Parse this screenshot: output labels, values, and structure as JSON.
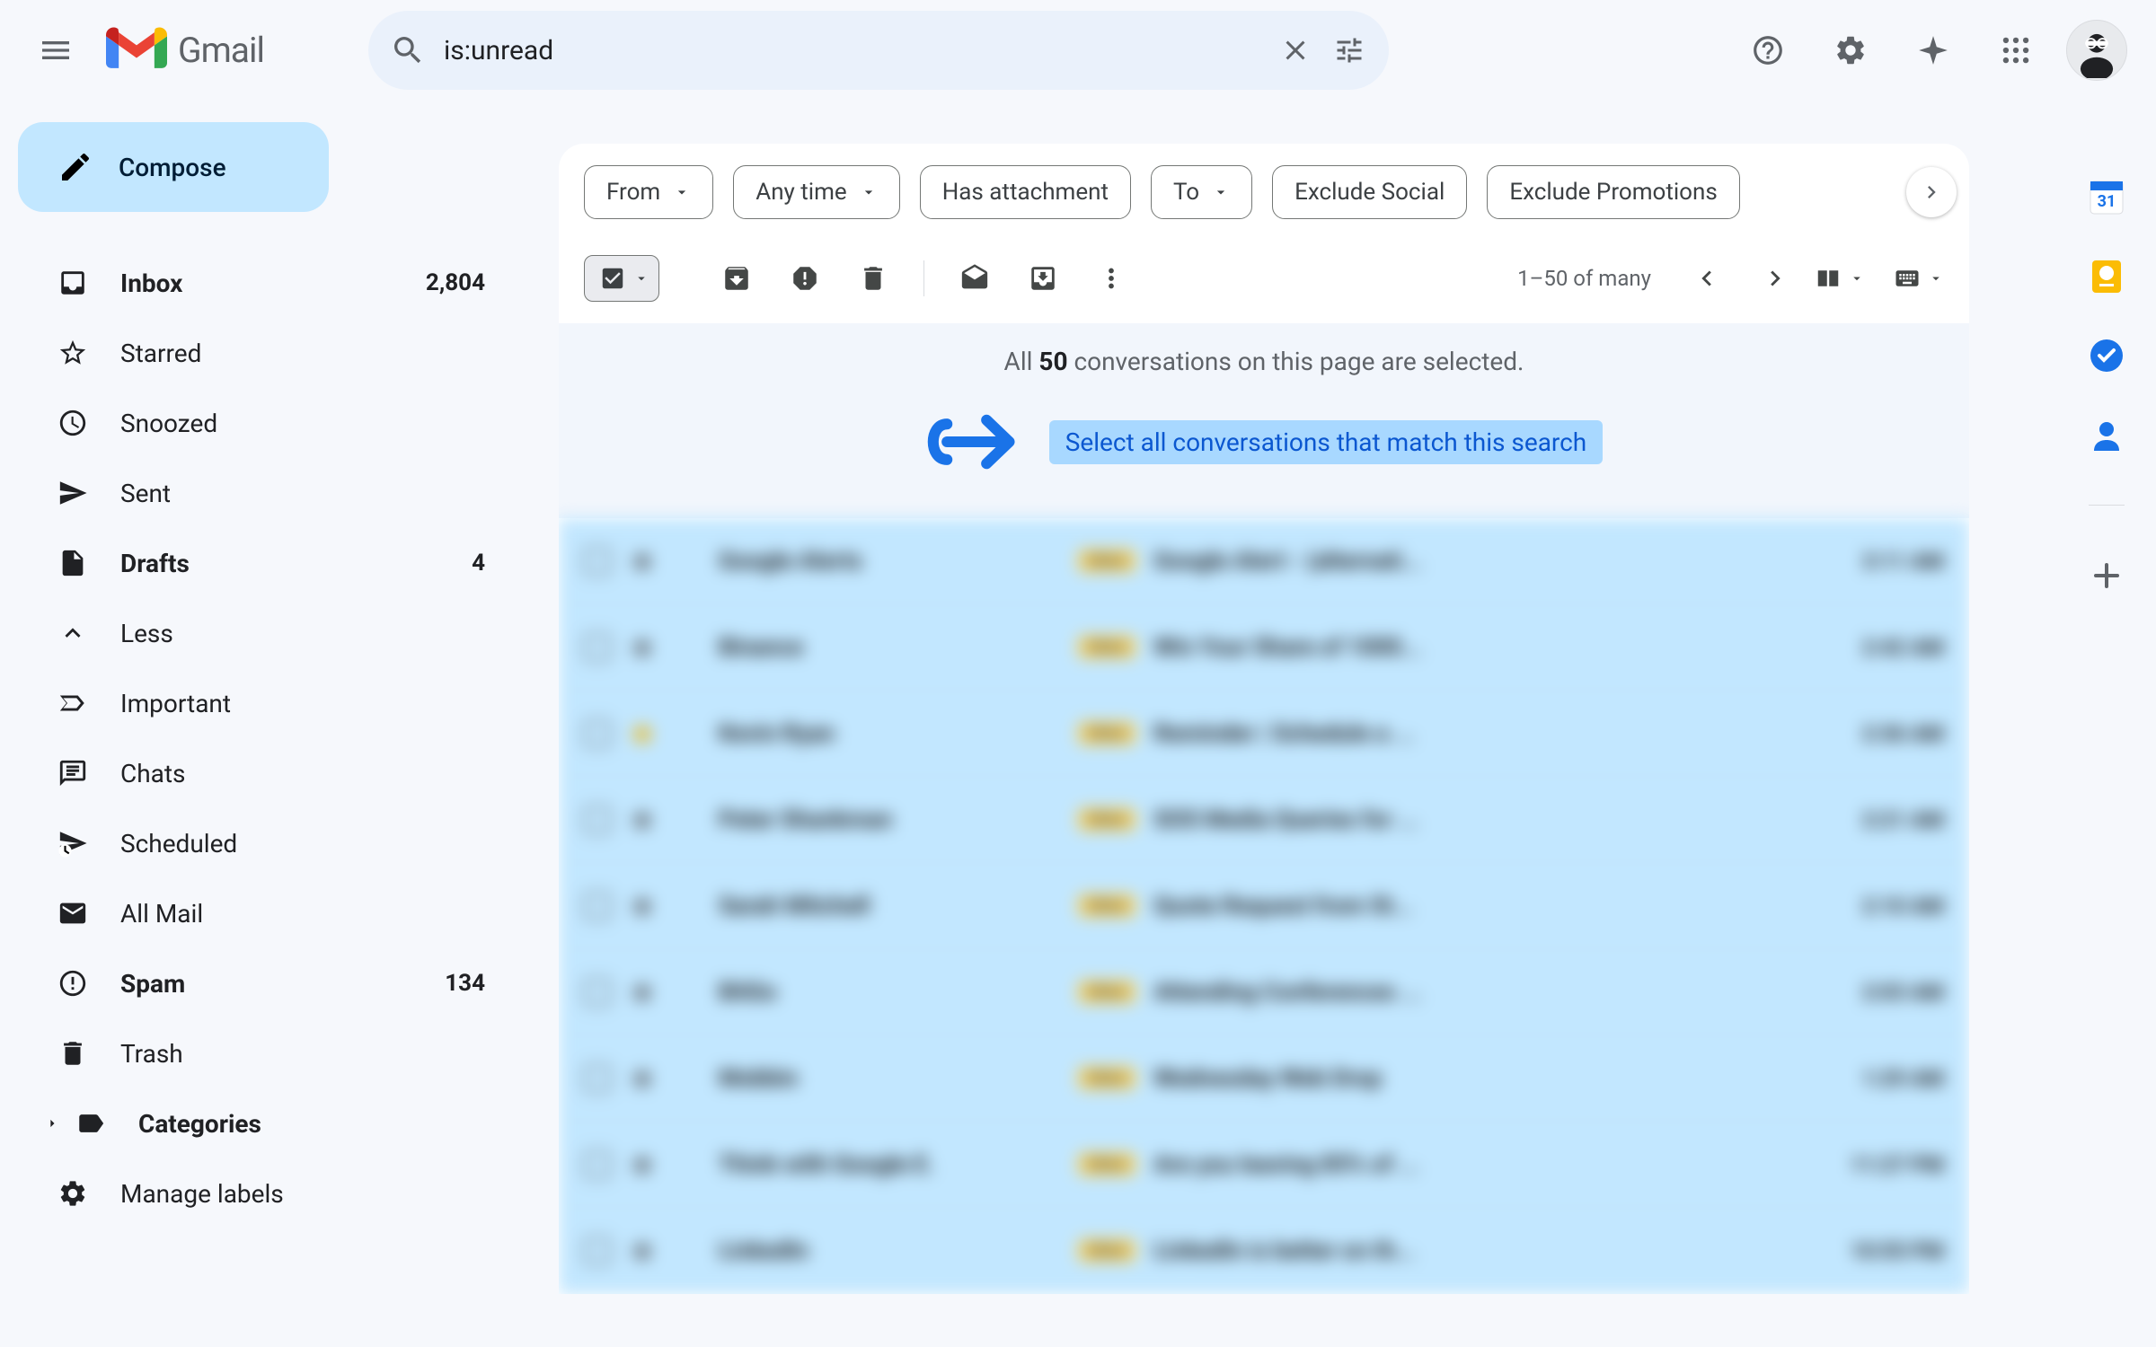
{
  "header": {
    "app_name": "Gmail",
    "search_value": "is:unread"
  },
  "compose_label": "Compose",
  "sidebar": {
    "items": [
      {
        "icon": "inbox",
        "label": "Inbox",
        "count": "2,804",
        "bold": true
      },
      {
        "icon": "star",
        "label": "Starred",
        "count": "",
        "bold": false
      },
      {
        "icon": "snooze",
        "label": "Snoozed",
        "count": "",
        "bold": false
      },
      {
        "icon": "send",
        "label": "Sent",
        "count": "",
        "bold": false
      },
      {
        "icon": "draft",
        "label": "Drafts",
        "count": "4",
        "bold": true
      },
      {
        "icon": "less",
        "label": "Less",
        "count": "",
        "bold": false
      },
      {
        "icon": "important",
        "label": "Important",
        "count": "",
        "bold": false
      },
      {
        "icon": "chats",
        "label": "Chats",
        "count": "",
        "bold": false
      },
      {
        "icon": "scheduled",
        "label": "Scheduled",
        "count": "",
        "bold": false
      },
      {
        "icon": "allmail",
        "label": "All Mail",
        "count": "",
        "bold": false
      },
      {
        "icon": "spam",
        "label": "Spam",
        "count": "134",
        "bold": true
      },
      {
        "icon": "trash",
        "label": "Trash",
        "count": "",
        "bold": false
      },
      {
        "icon": "categories",
        "label": "Categories",
        "count": "",
        "bold": true
      },
      {
        "icon": "manage",
        "label": "Manage labels",
        "count": "",
        "bold": false
      }
    ]
  },
  "filters": [
    {
      "label": "From",
      "has_arrow": true
    },
    {
      "label": "Any time",
      "has_arrow": true
    },
    {
      "label": "Has attachment",
      "has_arrow": false
    },
    {
      "label": "To",
      "has_arrow": true
    },
    {
      "label": "Exclude Social",
      "has_arrow": false
    },
    {
      "label": "Exclude Promotions",
      "has_arrow": false
    }
  ],
  "toolbar": {
    "pagination": "1–50 of many"
  },
  "banner": {
    "text_prefix": "All ",
    "count": "50",
    "text_suffix": " conversations on this page are selected.",
    "link": "Select all conversations that match this search"
  },
  "emails": [
    {
      "sender": "Google Alerts",
      "tag": "Inbox",
      "subject": "Google Alert - (alternati...",
      "time": "3:11 AM",
      "starred": false
    },
    {
      "sender": "Binance",
      "tag": "Inbox",
      "subject": "Win Your Share of 1000...",
      "time": "2:42 AM",
      "starred": false
    },
    {
      "sender": "Kevin Ryan",
      "tag": "Inbox",
      "subject": "Reminder | Schedule a ...",
      "time": "2:36 AM",
      "starred": true
    },
    {
      "sender": "Peter Shankman",
      "tag": "Inbox",
      "subject": "SOS Media Queries for ...",
      "time": "2:21 AM",
      "starred": false
    },
    {
      "sender": "Sarah Mitchell",
      "tag": "Inbox",
      "subject": "Quote Request from St...",
      "time": "2:10 AM",
      "starred": false
    },
    {
      "sender": "BitGo",
      "tag": "Inbox",
      "subject": "Attending Conferences ...",
      "time": "2:03 AM",
      "starred": false
    },
    {
      "sender": "Mobbin",
      "tag": "Inbox",
      "subject": "Wednesday Web Drop",
      "time": "1:29 AM",
      "starred": false
    },
    {
      "sender": "Think with Google E.",
      "tag": "Inbox",
      "subject": "Are you leaving 85% of ...",
      "time": "11:27 PM",
      "starred": false
    },
    {
      "sender": "LinkedIn",
      "tag": "Inbox",
      "subject": "LinkedIn is better on th...",
      "time": "10:55 PM",
      "starred": false
    }
  ]
}
